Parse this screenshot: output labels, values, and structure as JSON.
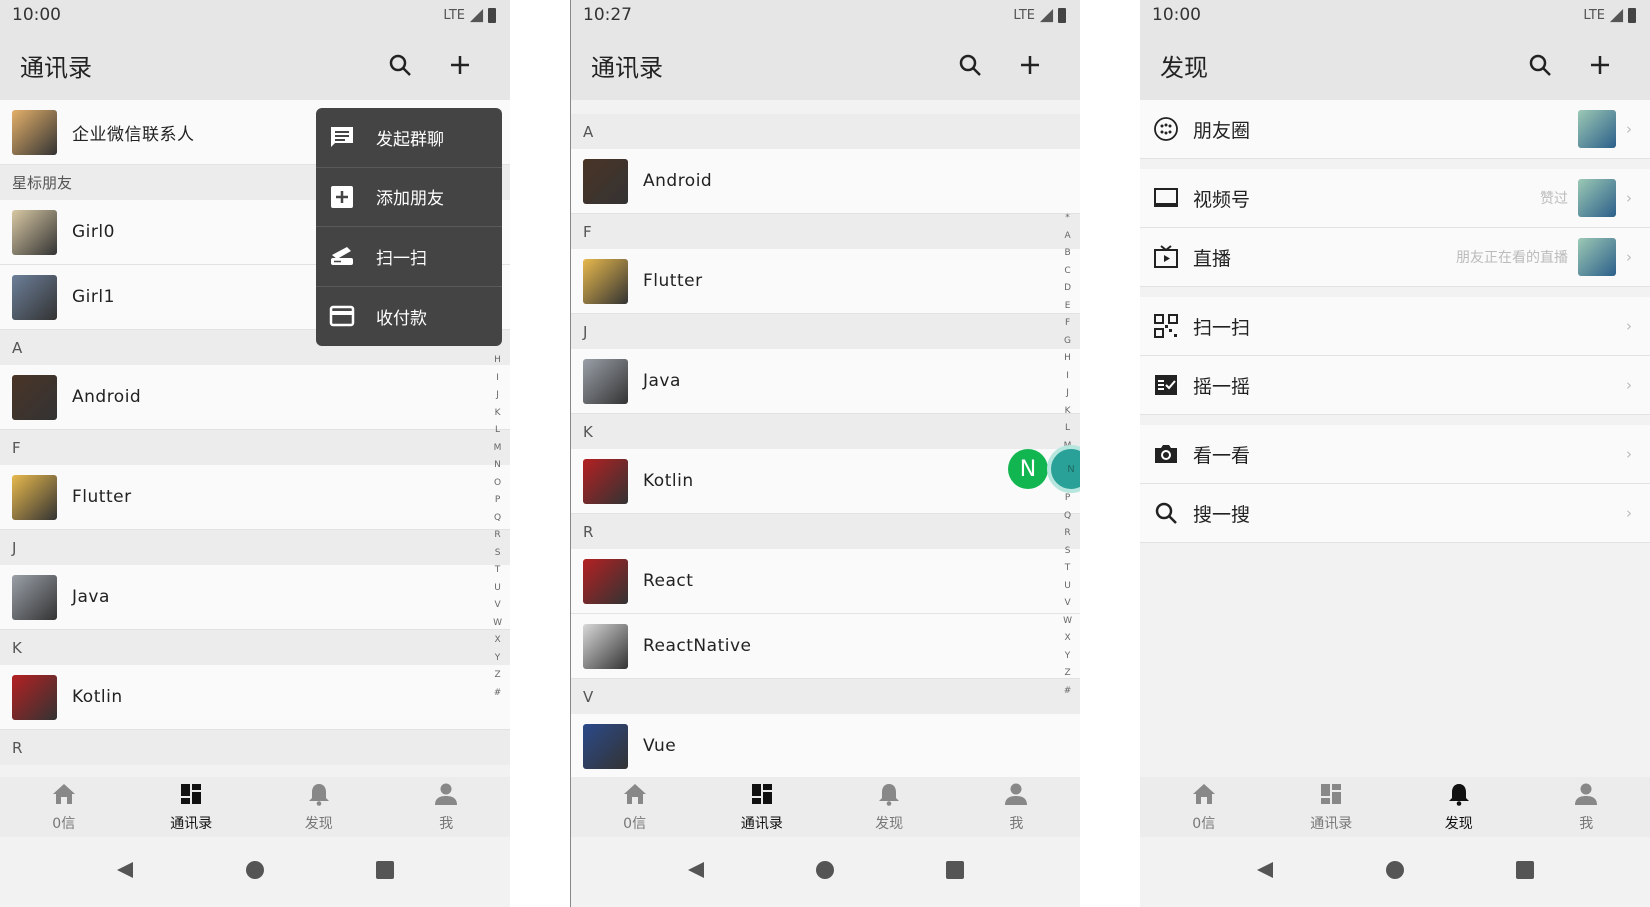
{
  "screen1": {
    "status_time": "10:00",
    "status_network": "LTE",
    "title": "通讯录",
    "rows": [
      {
        "type": "row",
        "label": "企业微信联系人",
        "color": "#e4b06a"
      },
      {
        "type": "section",
        "label": "星标朋友"
      },
      {
        "type": "row",
        "label": "Girl0",
        "color": "#d8c9a4"
      },
      {
        "type": "row",
        "label": "Girl1",
        "color": "#6c7f99"
      },
      {
        "type": "section",
        "label": "A"
      },
      {
        "type": "row",
        "label": "Android",
        "color": "#4a3426"
      },
      {
        "type": "section",
        "label": "F"
      },
      {
        "type": "row",
        "label": "Flutter",
        "color": "#e8b94d"
      },
      {
        "type": "section",
        "label": "J"
      },
      {
        "type": "row",
        "label": "Java",
        "color": "#9aa0a8"
      },
      {
        "type": "section",
        "label": "K"
      },
      {
        "type": "row",
        "label": "Kotlin",
        "color": "#b42022"
      },
      {
        "type": "section",
        "label": "R"
      }
    ],
    "alpha_index": [
      "H",
      "I",
      "J",
      "K",
      "L",
      "M",
      "N",
      "O",
      "P",
      "Q",
      "R",
      "S",
      "T",
      "U",
      "V",
      "W",
      "X",
      "Y",
      "Z",
      "#"
    ],
    "popup": [
      {
        "label": "发起群聊",
        "icon": "chat-icon"
      },
      {
        "label": "添加朋友",
        "icon": "add-friend-icon"
      },
      {
        "label": "扫一扫",
        "icon": "scan-icon"
      },
      {
        "label": "收付款",
        "icon": "payment-icon"
      }
    ],
    "nav": [
      {
        "label": "0信",
        "icon": "home-icon",
        "active": false
      },
      {
        "label": "通讯录",
        "icon": "contacts-icon",
        "active": true
      },
      {
        "label": "发现",
        "icon": "bell-icon",
        "active": false
      },
      {
        "label": "我",
        "icon": "person-icon",
        "active": false
      }
    ]
  },
  "screen2": {
    "status_time": "10:27",
    "status_network": "LTE",
    "title": "通讯录",
    "rows": [
      {
        "type": "section",
        "label": "A"
      },
      {
        "type": "row",
        "label": "Android",
        "color": "#4a3426"
      },
      {
        "type": "section",
        "label": "F"
      },
      {
        "type": "row",
        "label": "Flutter",
        "color": "#e8b94d"
      },
      {
        "type": "section",
        "label": "J"
      },
      {
        "type": "row",
        "label": "Java",
        "color": "#9aa0a8"
      },
      {
        "type": "section",
        "label": "K"
      },
      {
        "type": "row",
        "label": "Kotlin",
        "color": "#b42022"
      },
      {
        "type": "section",
        "label": "R"
      },
      {
        "type": "row",
        "label": "React",
        "color": "#b42022"
      },
      {
        "type": "row",
        "label": "ReactNative",
        "color": "#d9d9d9"
      },
      {
        "type": "section",
        "label": "V"
      },
      {
        "type": "row",
        "label": "Vue",
        "color": "#2b4a8a"
      }
    ],
    "alpha_index": [
      "*",
      "A",
      "B",
      "C",
      "D",
      "E",
      "F",
      "G",
      "H",
      "I",
      "J",
      "K",
      "L",
      "M",
      "N",
      "O",
      "P",
      "Q",
      "R",
      "S",
      "T",
      "U",
      "V",
      "W",
      "X",
      "Y",
      "Z",
      "#"
    ],
    "index_bubble": "N",
    "index_selected": "N",
    "nav": [
      {
        "label": "0信",
        "icon": "home-icon",
        "active": false
      },
      {
        "label": "通讯录",
        "icon": "contacts-icon",
        "active": true
      },
      {
        "label": "发现",
        "icon": "bell-icon",
        "active": false
      },
      {
        "label": "我",
        "icon": "person-icon",
        "active": false
      }
    ]
  },
  "screen3": {
    "status_time": "10:00",
    "status_network": "LTE",
    "title": "发现",
    "groups": [
      [
        {
          "label": "朋友圈",
          "icon": "moments-icon",
          "hint": "",
          "thumb": true
        }
      ],
      [
        {
          "label": "视频号",
          "icon": "video-channel-icon",
          "hint": "赞过",
          "thumb": true
        },
        {
          "label": "直播",
          "icon": "live-icon",
          "hint": "朋友正在看的直播",
          "thumb": true
        }
      ],
      [
        {
          "label": "扫一扫",
          "icon": "scan-qr-icon",
          "hint": "",
          "thumb": false
        },
        {
          "label": "摇一摇",
          "icon": "shake-icon",
          "hint": "",
          "thumb": false
        }
      ],
      [
        {
          "label": "看一看",
          "icon": "camera-icon",
          "hint": "",
          "thumb": false
        },
        {
          "label": "搜一搜",
          "icon": "search-icon",
          "hint": "",
          "thumb": false
        }
      ]
    ],
    "nav": [
      {
        "label": "0信",
        "icon": "home-icon",
        "active": false
      },
      {
        "label": "通讯录",
        "icon": "contacts-icon",
        "active": false
      },
      {
        "label": "发现",
        "icon": "bell-icon",
        "active": true
      },
      {
        "label": "我",
        "icon": "person-icon",
        "active": false
      }
    ]
  },
  "colors": {
    "accent_green": "#11b650",
    "popup_bg": "#444444",
    "appbar_bg": "#e6e6e6"
  }
}
